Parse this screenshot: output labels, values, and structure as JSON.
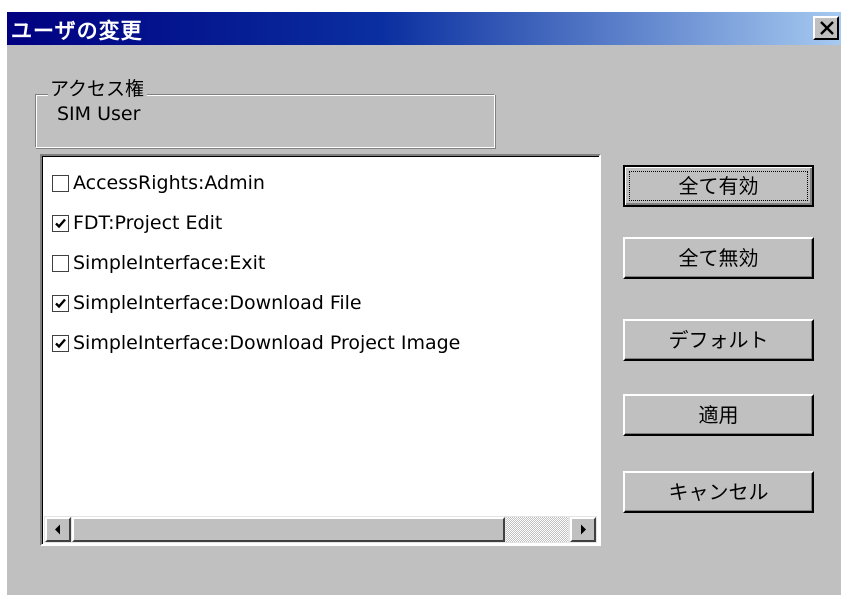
{
  "window": {
    "title": "ユーザの変更"
  },
  "access_group": {
    "label": "アクセス権",
    "value": "SIM User"
  },
  "permissions": {
    "items": [
      {
        "label": "AccessRights:Admin",
        "checked": false
      },
      {
        "label": "FDT:Project Edit",
        "checked": true
      },
      {
        "label": "SimpleInterface:Exit",
        "checked": false
      },
      {
        "label": "SimpleInterface:Download File",
        "checked": true
      },
      {
        "label": "SimpleInterface:Download Project Image",
        "checked": true
      }
    ]
  },
  "buttons": {
    "enable_all": "全て有効",
    "disable_all": "全て無効",
    "default": "デフォルト",
    "apply": "適用",
    "cancel": "キャンセル"
  },
  "icons": {
    "close": "close-icon",
    "scroll_left": "arrow-left-icon",
    "scroll_right": "arrow-right-icon",
    "check": "checkmark-icon"
  }
}
